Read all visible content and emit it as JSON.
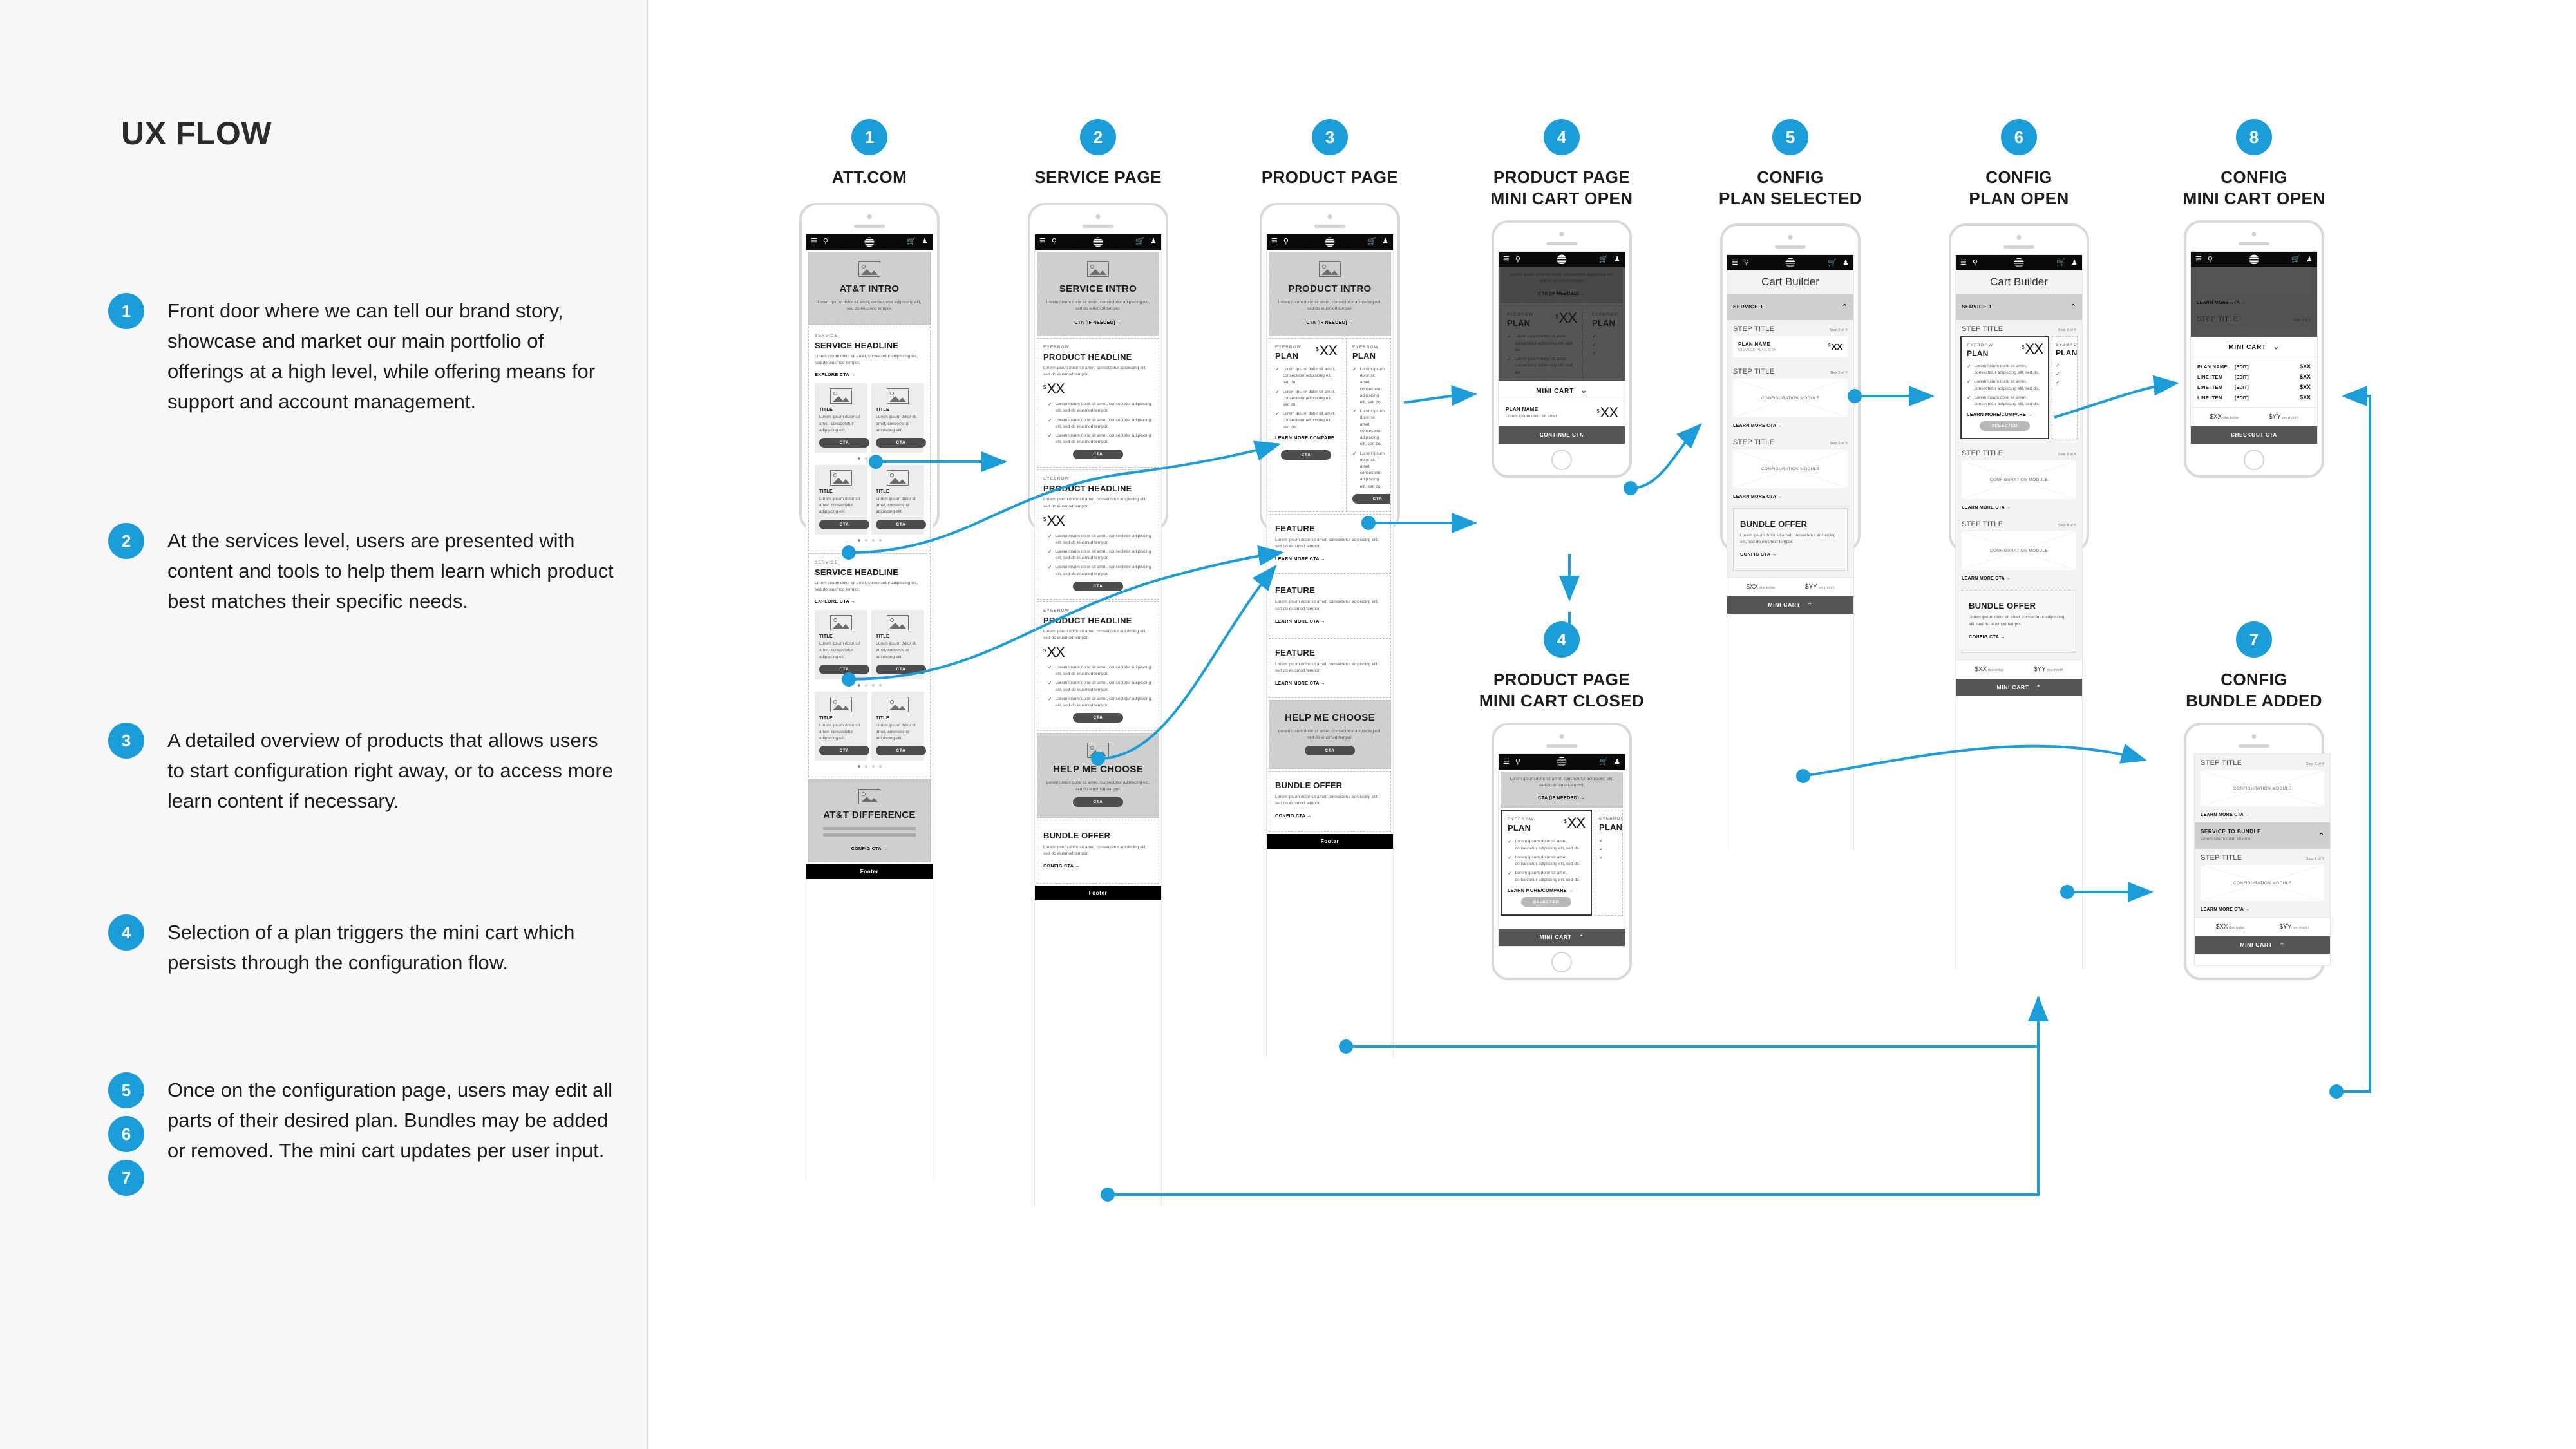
{
  "page": {
    "title": "UX FLOW",
    "accent": "#1b9dd9"
  },
  "legend": [
    {
      "num": "1",
      "text": "Front door where we can tell our brand story, showcase and market our main portfolio of offerings at a high level, while offering means for support and account management."
    },
    {
      "num": "2",
      "text": "At the services level, users are presented with content and tools to help them learn which product best matches their specific needs."
    },
    {
      "num": "3",
      "text": "A detailed overview of products that allows users to start configuration right away, or to access more learn content if necessary."
    },
    {
      "num": "4",
      "text": "Selection of a plan triggers the mini cart which persists through the configuration flow."
    },
    {
      "num": "567",
      "nums": [
        "5",
        "6",
        "7"
      ],
      "text": "Once on the configuration page, users may edit all parts of their desired plan. Bundles may be added or removed. The mini cart updates per user input."
    }
  ],
  "common": {
    "lorem_long": "Lorem ipsum dolor sit amet, consectetur adipiscing elit, sed do eiusmod tempor.",
    "lorem_short": "Lorem ipsum dolor sit amet, consectetur adipiscing elit.",
    "lorem_plan": "Lorem ipsum dolor sit amet, consectetur adipiscing elit, sed do.",
    "lorem_tiny": "Lorem ipsum dolor sit amet",
    "footer": "Footer",
    "cta": "CTA",
    "cta_if_needed": "CTA (IF NEEDED)  →",
    "explore_cta": "EXPLORE CTA  →",
    "config_cta": "CONFIG CTA  →",
    "learn_more_cta": "LEARN MORE CTA  →",
    "learn_more_compare": "LEARN MORE/COMPARE  →",
    "eyebrow": "EYEBROW",
    "service_label": "SERVICE",
    "service_headline": "SERVICE HEADLINE",
    "product_headline": "PRODUCT HEADLINE",
    "title": "TITLE",
    "feature": "FEATURE",
    "help_me_choose": "HELP ME CHOOSE",
    "bundle_offer": "BUNDLE OFFER",
    "att_difference": "AT&T DIFFERENCE",
    "plan": "PLAN",
    "selected": "SELECTED",
    "dollar": "$",
    "xx": "XX",
    "step_title": "STEP TITLE",
    "step_x_of_y": "Step X of Y",
    "config_module": "CONFIGURATION MODULE",
    "cart_builder": "Cart Builder",
    "service_1": "SERVICE 1",
    "service_to_bundle": "SERVICE TO BUNDLE",
    "plan_name": "PLAN NAME",
    "change_plan_cta": "CHANGE PLAN CTA",
    "line_item": "LINE ITEM",
    "edit": "[EDIT]",
    "mini_cart": "MINI CART",
    "continue_cta": "CONTINUE CTA",
    "checkout_cta": "CHECKOUT CTA",
    "due_today_amt": "$XX",
    "due_today_lbl": "due today",
    "per_month_amt": "$YY",
    "per_month_lbl": "per month",
    "price_xx": "$XX"
  },
  "screens": [
    {
      "num": "1",
      "title": "ATT.COM",
      "hero": "AT&T INTRO"
    },
    {
      "num": "2",
      "title": "SERVICE PAGE",
      "hero": "SERVICE INTRO"
    },
    {
      "num": "3",
      "title": "PRODUCT PAGE",
      "hero": "PRODUCT INTRO"
    },
    {
      "num": "4",
      "title": "PRODUCT PAGE\nMINI CART OPEN",
      "title_l1": "PRODUCT PAGE",
      "title_l2": "MINI CART OPEN"
    },
    {
      "num": "4",
      "title": "PRODUCT PAGE\nMINI CART CLOSED",
      "title_l1": "PRODUCT PAGE",
      "title_l2": "MINI CART CLOSED"
    },
    {
      "num": "5",
      "title": "CONFIG\nPLAN SELECTED",
      "title_l1": "CONFIG",
      "title_l2": "PLAN SELECTED"
    },
    {
      "num": "6",
      "title": "CONFIG\nPLAN OPEN",
      "title_l1": "CONFIG",
      "title_l2": "PLAN OPEN"
    },
    {
      "num": "8",
      "title": "CONFIG\nMINI CART OPEN",
      "title_l1": "CONFIG",
      "title_l2": "MINI CART OPEN"
    },
    {
      "num": "7",
      "title": "CONFIG\nBUNDLE ADDED",
      "title_l1": "CONFIG",
      "title_l2": "BUNDLE ADDED"
    }
  ],
  "icons": {
    "hamburger": "☰",
    "search": "⚲",
    "cart": "🛒",
    "user": "♟",
    "chevron_up": "⌃",
    "chevron_down": "⌄"
  }
}
